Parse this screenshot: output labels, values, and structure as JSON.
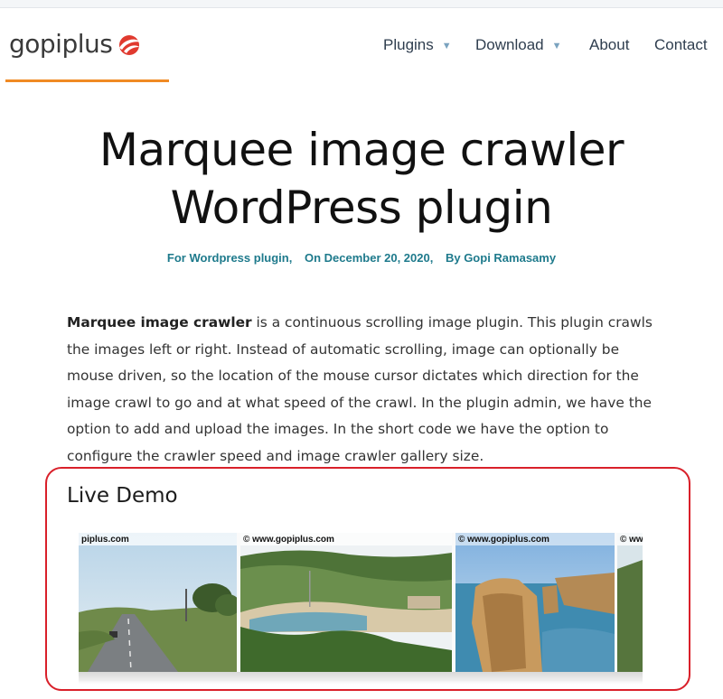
{
  "logo": {
    "text": "gopiplus"
  },
  "nav": [
    {
      "label": "Plugins",
      "caret": "▼"
    },
    {
      "label": "Download",
      "caret": "▼"
    },
    {
      "label": "About"
    },
    {
      "label": "Contact"
    }
  ],
  "article": {
    "title_line1": "Marquee image crawler",
    "title_line2": "WordPress plugin",
    "meta": {
      "category": "For Wordpress plugin,",
      "date": "On December 20, 2020,",
      "author": "By Gopi Ramasamy"
    },
    "intro_bold": "Marquee image crawler",
    "intro_rest": " is a continuous scrolling image plugin. This plugin crawls the images left or right. Instead of automatic scrolling, image can optionally be mouse driven, so the location of the mouse cursor dictates which direction for the image crawl to go and at what speed of the crawl. In the plugin admin, we have the option to add and upload the images. In the short code we have the option to configure the crawler speed and image crawler gallery size."
  },
  "demo": {
    "heading": "Live Demo",
    "images": [
      {
        "caption": "piplus.com"
      },
      {
        "caption": "© www.gopiplus.com"
      },
      {
        "caption": "© www.gopiplus.com"
      },
      {
        "caption": "© ww"
      }
    ]
  },
  "colors": {
    "accent_orange": "#f08a24",
    "meta_teal": "#1e7a8c",
    "highlight_red": "#d9202a"
  }
}
